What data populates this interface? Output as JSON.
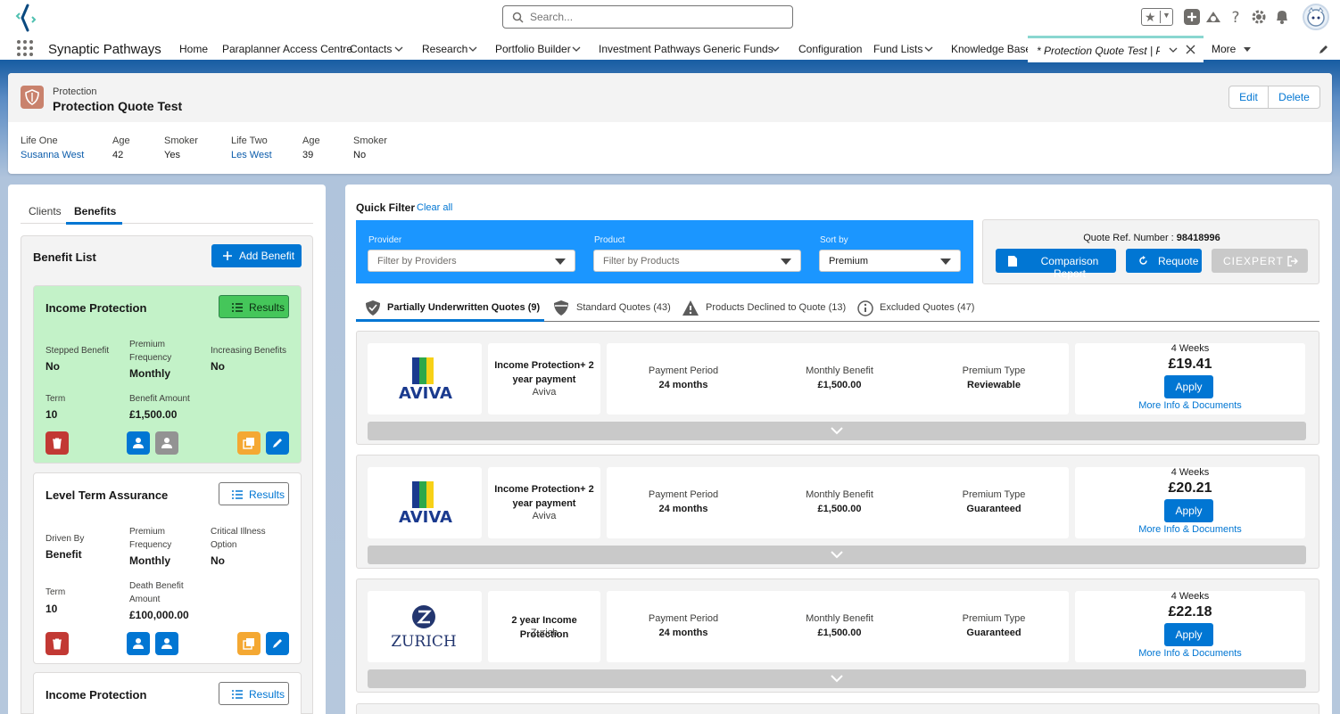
{
  "app": {
    "name": "Synaptic Pathways"
  },
  "search": {
    "placeholder": "Search..."
  },
  "nav": {
    "items": [
      {
        "label": "Home"
      },
      {
        "label": "Paraplanner Access Centre"
      },
      {
        "label": "Contacts"
      },
      {
        "label": "Research"
      },
      {
        "label": "Portfolio Builder"
      },
      {
        "label": "Investment Pathways"
      },
      {
        "label": "Generic Funds"
      },
      {
        "label": "Configuration"
      },
      {
        "label": "Fund Lists"
      },
      {
        "label": "Knowledge Base"
      }
    ],
    "active_tab": "* Protection Quote Test | Pro...",
    "more": "More"
  },
  "record": {
    "type": "Protection",
    "title": "Protection Quote Test",
    "edit": "Edit",
    "delete": "Delete",
    "fields": [
      {
        "label": "Life One",
        "value": "Susanna West"
      },
      {
        "label": "Age",
        "value": "42"
      },
      {
        "label": "Smoker",
        "value": "Yes"
      },
      {
        "label": "Life Two",
        "value": "Les West"
      },
      {
        "label": "Age",
        "value": "39"
      },
      {
        "label": "Smoker",
        "value": "No"
      }
    ]
  },
  "left": {
    "tabs": [
      "Clients",
      "Benefits"
    ],
    "active_tab": "Benefits",
    "benefit_list_title": "Benefit List",
    "add_benefit": "Add Benefit",
    "results_label": "Results",
    "cards": [
      {
        "title": "Income Protection",
        "selected": true,
        "fields": [
          {
            "label": "Stepped Benefit",
            "value": "No"
          },
          {
            "label": "Premium Frequency",
            "value": "Monthly"
          },
          {
            "label": "Increasing Benefits",
            "value": "No"
          },
          {
            "label": "Term",
            "value": "10"
          },
          {
            "label": "Benefit Amount",
            "value": "£1,500.00"
          }
        ]
      },
      {
        "title": "Level Term Assurance",
        "selected": false,
        "fields": [
          {
            "label": "Driven By",
            "value": "Benefit"
          },
          {
            "label": "Premium Frequency",
            "value": "Monthly"
          },
          {
            "label": "Critical Illness Option",
            "value": "No"
          },
          {
            "label": "Term",
            "value": "10"
          },
          {
            "label": "Death Benefit Amount",
            "value": "£100,000.00"
          }
        ]
      },
      {
        "title": "Income Protection",
        "selected": false
      }
    ]
  },
  "right": {
    "quick_filter": "Quick Filter",
    "clear_all": "Clear all",
    "filters": [
      {
        "label": "Provider",
        "placeholder": "Filter by Providers"
      },
      {
        "label": "Product",
        "placeholder": "Filter by Products"
      },
      {
        "label": "Sort by",
        "value": "Premium"
      }
    ],
    "quote_ref_label": "Quote Ref. Number :",
    "quote_ref": "98418996",
    "comparison_report": "Comparison Report",
    "requote": "Requote",
    "ciexpert": "CIEXPERT",
    "quote_tabs": [
      {
        "label": "Partially Underwritten Quotes (9)",
        "icon": "shield-check-icon"
      },
      {
        "label": "Standard Quotes (43)",
        "icon": "shield-icon"
      },
      {
        "label": "Products Declined to Quote (13)",
        "icon": "warning-icon"
      },
      {
        "label": "Excluded Quotes (47)",
        "icon": "info-icon"
      }
    ],
    "quotes": [
      {
        "provider_logo": "AVIVA",
        "product": "Income Protection+ 2 year payment",
        "provider": "Aviva",
        "payment_period_label": "Payment Period",
        "payment_period": "24 months",
        "monthly_benefit_label": "Monthly Benefit",
        "monthly_benefit": "£1,500.00",
        "premium_type_label": "Premium Type",
        "premium_type": "Reviewable",
        "frequency": "4 Weeks",
        "price": "£19.41",
        "apply": "Apply",
        "more_info": "More Info & Documents"
      },
      {
        "provider_logo": "AVIVA",
        "product": "Income Protection+ 2 year payment",
        "provider": "Aviva",
        "payment_period_label": "Payment Period",
        "payment_period": "24 months",
        "monthly_benefit_label": "Monthly Benefit",
        "monthly_benefit": "£1,500.00",
        "premium_type_label": "Premium Type",
        "premium_type": "Guaranteed",
        "frequency": "4 Weeks",
        "price": "£20.21",
        "apply": "Apply",
        "more_info": "More Info & Documents"
      },
      {
        "provider_logo": "ZURICH",
        "product": "2 year Income Protection",
        "provider": "Zurich",
        "payment_period_label": "Payment Period",
        "payment_period": "24 months",
        "monthly_benefit_label": "Monthly Benefit",
        "monthly_benefit": "£1,500.00",
        "premium_type_label": "Premium Type",
        "premium_type": "Guaranteed",
        "frequency": "4 Weeks",
        "price": "£22.18",
        "apply": "Apply",
        "more_info": "More Info & Documents"
      }
    ]
  },
  "colors": {
    "brand": "#0176d3",
    "filter_bar": "#1b96ff",
    "selected_card": "#c3f2c8",
    "results_green": "#45c65a",
    "delete_red": "#c23934",
    "copy_orange": "#f4a833",
    "aviva_blue": "#1a3a8e",
    "zurich_blue": "#23366f"
  }
}
